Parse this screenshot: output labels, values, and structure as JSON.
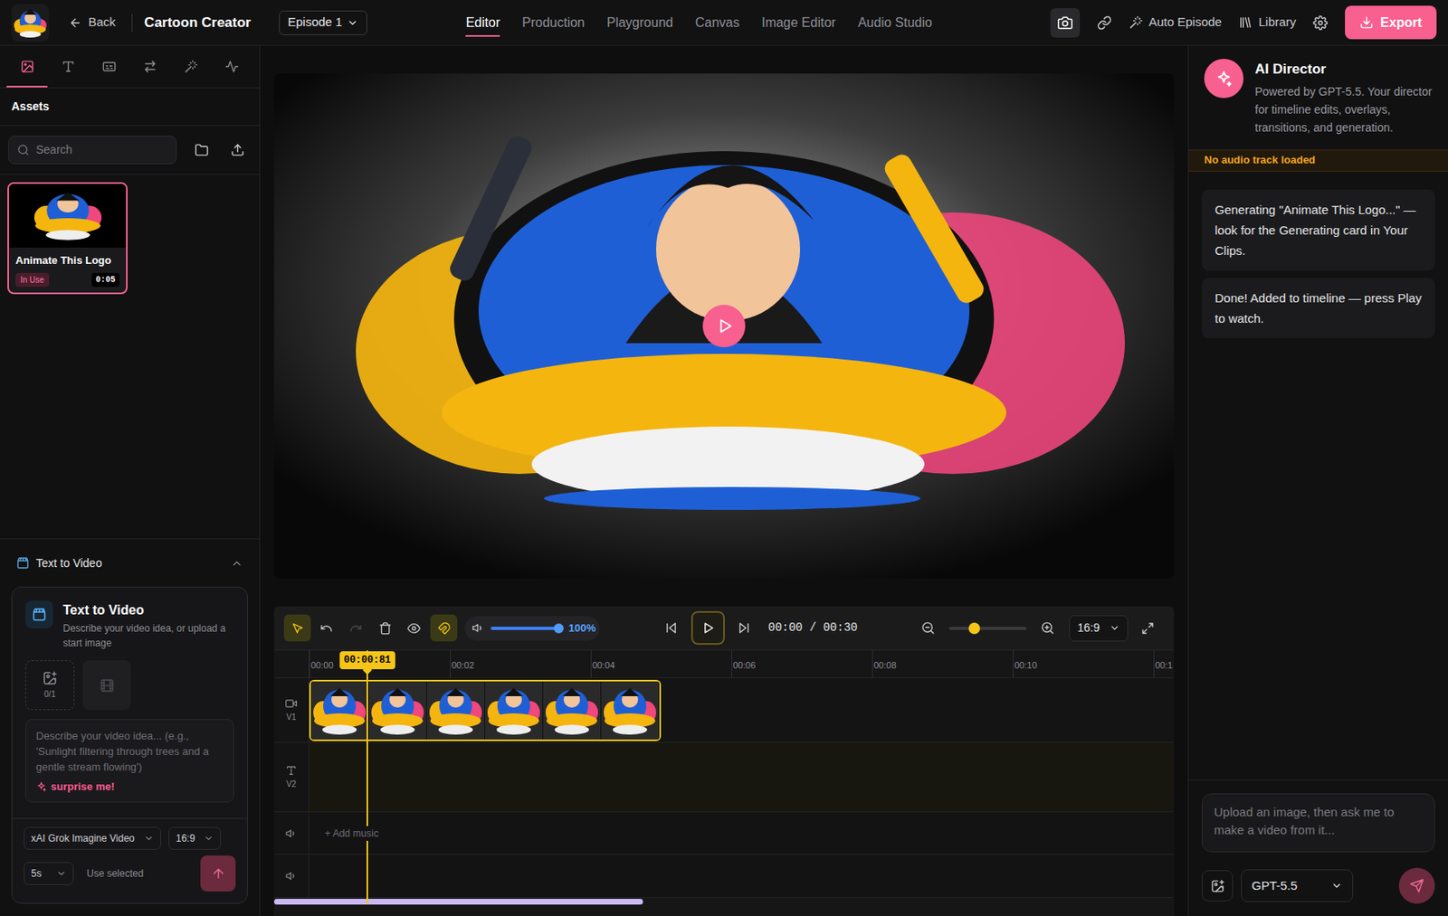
{
  "header": {
    "back": "Back",
    "title": "Cartoon Creator",
    "episode": "Episode 1",
    "nav": [
      {
        "label": "Editor",
        "selected": true
      },
      {
        "label": "Production",
        "selected": false
      },
      {
        "label": "Playground",
        "selected": false
      },
      {
        "label": "Canvas",
        "selected": false
      },
      {
        "label": "Image Editor",
        "selected": false
      },
      {
        "label": "Audio Studio",
        "selected": false
      }
    ],
    "actions": [
      {
        "label": "Auto Episode"
      },
      {
        "label": "Library"
      }
    ],
    "export": "Export"
  },
  "sidebar": {
    "tabs": [
      {
        "selected": true
      },
      {
        "selected": false
      },
      {
        "selected": false
      },
      {
        "selected": false
      },
      {
        "selected": false
      },
      {
        "selected": false
      }
    ],
    "title": "Assets",
    "search_placeholder": "Search",
    "assets": [
      {
        "title": "Animate This Logo",
        "badge": "In Use",
        "duration": "0:05",
        "selected": true
      }
    ]
  },
  "text_to_video": {
    "section_title": "Text to Video",
    "expanded": true,
    "card_title": "Text to Video",
    "description": "Describe your video idea, or upload a start image",
    "upload_count": "0/1",
    "prompt_placeholder": "Describe your video idea... (e.g., 'Sunlight filtering through trees and a gentle stream flowing')",
    "surprise": "surprise me!",
    "model": "xAI Grok Imagine Video",
    "aspect": "16:9",
    "duration": "5s",
    "use_selected": "Use selected"
  },
  "preview": {
    "playing": false
  },
  "timeline": {
    "tools": [
      {
        "selected": true,
        "disabled": false
      },
      {
        "selected": false,
        "disabled": false
      },
      {
        "selected": false,
        "disabled": true
      },
      {
        "selected": false,
        "disabled": false
      },
      {
        "selected": false,
        "disabled": false
      },
      {
        "selected": true,
        "disabled": false
      }
    ],
    "volume": {
      "level": 1,
      "reading": "100%"
    },
    "playing": false,
    "time": "00:00 / 00:30",
    "zoom": {
      "level": 0.33
    },
    "aspect": "16:9",
    "ruler": [
      "00:00",
      "00:02",
      "00:04",
      "00:06",
      "00:08",
      "00:10",
      "00:1"
    ],
    "playhead": {
      "label": "00:00:81",
      "seconds": 0.83
    },
    "tracks": [
      {
        "label": "V1",
        "kind": "video"
      },
      {
        "label": "V2",
        "kind": "text"
      },
      {
        "kind": "audio",
        "hint": "+ Add music"
      },
      {
        "kind": "audio"
      }
    ],
    "clips": [
      {
        "track": 0,
        "start": 0,
        "duration": 5,
        "frames": 6,
        "selected": true
      }
    ],
    "scroll": {
      "level": 0.41
    }
  },
  "director": {
    "title": "AI Director",
    "description": "Powered by GPT-5.5. Your director for timeline edits, overlays, transitions, and generation.",
    "warning": "No audio track loaded",
    "messages": [
      "Generating \"Animate This Logo...\" — look for the Generating card in Your Clips.",
      "Done! Added to timeline — press Play to watch."
    ],
    "input_placeholder": "Upload an image, then ask me to make a video from it...",
    "model": "GPT-5.5"
  }
}
